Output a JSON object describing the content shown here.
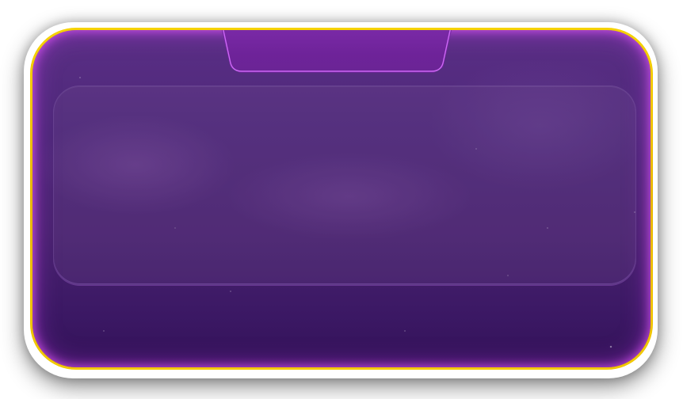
{
  "panel": {
    "title": "",
    "content_text": "",
    "footer_text": ""
  },
  "colors": {
    "frame_gold": "#f2c900",
    "panel_purple_top": "#5b2f86",
    "panel_purple_bottom": "#331258",
    "inner_glow_magenta": "#e65aff",
    "header_tab_purple": "#7b2aa8",
    "backdrop": "#ffffff"
  }
}
